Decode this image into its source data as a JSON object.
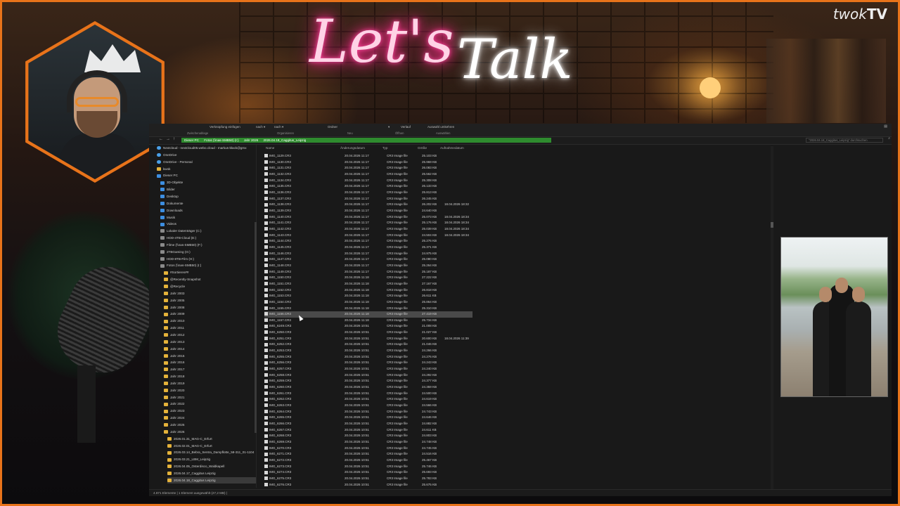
{
  "overlay": {
    "title_part1": "Let's",
    "title_part2": "Talk",
    "logo_part1": "twok",
    "logo_part2": "TV"
  },
  "ribbon": {
    "items": [
      "Verknüpfung einfügen",
      "nach ▾",
      "nach ▾",
      "Ordner",
      "▾",
      "Verlauf",
      "Auswahl umkehren"
    ],
    "groups": [
      "Zwischenablage",
      "Organisieren",
      "Neu",
      "Öffnen",
      "Auswählen"
    ]
  },
  "address": {
    "crumbs": [
      "Dieser PC",
      "Fotos (\\\\nas-SMB50) (I:)",
      "Jahr 2026",
      "2026.04.18_Caggitus_Leipzig"
    ],
    "search_placeholder": "\"2026.04.18_Caggitus_Leipzig\" durchsuchen"
  },
  "tree": [
    "Nextcloud - nextcloud05.webo.cloud - markus-black@gmx",
    "OneDrive",
    "OneDrive - Personal",
    "kwok",
    "Dieser PC",
    "3D-Objekte",
    "Bilder",
    "Desktop",
    "Dokumente",
    "Downloads",
    "Musik",
    "Videos",
    "Lokaler Datenträger (C:)",
    "HDD-4TB-Cloud (E:)",
    "Filme (\\\\nas-SMB50) (F:)",
    "2TBGaming (G:)",
    "HDD-8TB-Film (H:)",
    "Fotos (\\\\nas-SMB50) (I:)",
    "#Sortieren##",
    "@Recently-Snapshot",
    "@Recycle",
    "Jahr 2003",
    "Jahr 2005",
    "Jahr 2008",
    "Jahr 2009",
    "Jahr 2010",
    "Jahr 2011",
    "Jahr 2012",
    "Jahr 2013",
    "Jahr 2014",
    "Jahr 2015",
    "Jahr 2016",
    "Jahr 2017",
    "Jahr 2018",
    "Jahr 2019",
    "Jahr 2020",
    "Jahr 2021",
    "Jahr 2022",
    "Jahr 2023",
    "Jahr 2024",
    "Jahr 2025",
    "Jahr 2026",
    "2026.01.31_MAG-C_Erfurt",
    "2026.02.01_MAG-C_Erfurt",
    "2026.03.14_Bebra_Sentra_Dampflotte_58-311_01-1104",
    "2026.03.21_LBM_Leipzig",
    "2026.04.05_Osterdisco_Waldkapell",
    "2026.04.17_Caggitus Leipzig",
    "2026.04.18_Caggitus Leipzig"
  ],
  "columns": [
    "Name",
    "Änderungsdatum",
    "Typ",
    "Größe",
    "Aufnahmedatum"
  ],
  "files": [
    [
      "IMG_1129.CR3",
      "20.04.2026 11:17",
      "CR3 Image file",
      "25.103 KB",
      ""
    ],
    [
      "IMG_1130.CR3",
      "20.04.2026 11:17",
      "CR3 Image file",
      "25.969 KB",
      ""
    ],
    [
      "IMG_1131.CR3",
      "20.04.2026 11:17",
      "CR3 Image file",
      "26.083 KB",
      ""
    ],
    [
      "IMG_1132.CR3",
      "20.04.2026 11:17",
      "CR3 Image file",
      "25.562 KB",
      ""
    ],
    [
      "IMG_1134.CR3",
      "20.04.2026 11:17",
      "CR3 Image file",
      "25.308 KB",
      ""
    ],
    [
      "IMG_1135.CR3",
      "20.04.2026 11:17",
      "CR3 Image file",
      "26.133 KB",
      ""
    ],
    [
      "IMG_1136.CR3",
      "20.04.2026 11:17",
      "CR3 Image file",
      "25.813 KB",
      ""
    ],
    [
      "IMG_1137.CR3",
      "20.04.2026 11:17",
      "CR3 Image file",
      "26.245 KB",
      ""
    ],
    [
      "IMG_1138.CR3",
      "20.04.2026 11:17",
      "CR3 Image file",
      "26.202 KB",
      "18.04.2026 18:32"
    ],
    [
      "IMG_1139.CR3",
      "20.04.2026 11:17",
      "CR3 Image file",
      "24.640 KB",
      ""
    ],
    [
      "IMG_1140.CR3",
      "20.04.2026 11:17",
      "CR3 Image file",
      "25.073 KB",
      "18.04.2026 18:34"
    ],
    [
      "IMG_1141.CR3",
      "20.04.2026 11:17",
      "CR3 Image file",
      "25.176 KB",
      "18.04.2026 18:34"
    ],
    [
      "IMG_1142.CR3",
      "20.04.2026 11:17",
      "CR3 Image file",
      "25.039 KB",
      "18.04.2026 18:34"
    ],
    [
      "IMG_1143.CR3",
      "20.04.2026 11:17",
      "CR3 Image file",
      "24.504 KB",
      "18.04.2026 18:34"
    ],
    [
      "IMG_1144.CR3",
      "20.04.2026 11:17",
      "CR3 Image file",
      "25.276 KB",
      ""
    ],
    [
      "IMG_1145.CR3",
      "20.04.2026 11:17",
      "CR3 Image file",
      "25.371 KB",
      ""
    ],
    [
      "IMG_1146.CR3",
      "20.04.2026 11:17",
      "CR3 Image file",
      "24.975 KB",
      ""
    ],
    [
      "IMG_1147.CR3",
      "20.04.2026 11:17",
      "CR3 Image file",
      "25.080 KB",
      ""
    ],
    [
      "IMG_1148.CR3",
      "20.04.2026 11:17",
      "CR3 Image file",
      "25.264 KB",
      ""
    ],
    [
      "IMG_1149.CR3",
      "20.04.2026 11:17",
      "CR3 Image file",
      "25.187 KB",
      ""
    ],
    [
      "IMG_1150.CR3",
      "20.04.2026 11:18",
      "CR3 Image file",
      "27.222 KB",
      ""
    ],
    [
      "IMG_1151.CR3",
      "20.04.2026 11:18",
      "CR3 Image file",
      "27.167 KB",
      ""
    ],
    [
      "IMG_1152.CR3",
      "20.04.2026 11:18",
      "CR3 Image file",
      "26.818 KB",
      ""
    ],
    [
      "IMG_1153.CR3",
      "20.04.2026 11:18",
      "CR3 Image file",
      "26.611 KB",
      ""
    ],
    [
      "IMG_1154.CR3",
      "20.04.2026 11:18",
      "CR3 Image file",
      "25.864 KB",
      ""
    ],
    [
      "IMG_1155.CR3",
      "20.04.2026 11:18",
      "CR3 Image file",
      "25.310 KB",
      ""
    ],
    [
      "IMG_1156.CR3",
      "20.04.2026 11:18",
      "CR3 Image file",
      "27.419 KB",
      ""
    ],
    [
      "IMG_1157.CR3",
      "20.04.2026 11:18",
      "CR3 Image file",
      "25.734 KB",
      ""
    ],
    [
      "IMG_6249.CR3",
      "20.04.2026 10:51",
      "CR3 Image file",
      "21.008 KB",
      ""
    ],
    [
      "IMG_6250.CR3",
      "20.04.2026 10:51",
      "CR3 Image file",
      "21.027 KB",
      ""
    ],
    [
      "IMG_6251.CR3",
      "20.04.2026 10:51",
      "CR3 Image file",
      "20.600 KB",
      "18.04.2026 11:39"
    ],
    [
      "IMG_6252.CR3",
      "20.04.2026 10:51",
      "CR3 Image file",
      "21.046 KB",
      ""
    ],
    [
      "IMG_6253.CR3",
      "20.04.2026 10:51",
      "CR3 Image file",
      "24.266 KB",
      ""
    ],
    [
      "IMG_6255.CR3",
      "20.04.2026 10:51",
      "CR3 Image file",
      "24.276 KB",
      ""
    ],
    [
      "IMG_6256.CR3",
      "20.04.2026 10:51",
      "CR3 Image file",
      "24.243 KB",
      ""
    ],
    [
      "IMG_6257.CR3",
      "20.04.2026 10:51",
      "CR3 Image file",
      "24.240 KB",
      ""
    ],
    [
      "IMG_6258.CR3",
      "20.04.2026 10:51",
      "CR3 Image file",
      "24.292 KB",
      ""
    ],
    [
      "IMG_6259.CR3",
      "20.04.2026 10:51",
      "CR3 Image file",
      "24.377 KB",
      ""
    ],
    [
      "IMG_6260.CR3",
      "20.04.2026 10:51",
      "CR3 Image file",
      "24.359 KB",
      ""
    ],
    [
      "IMG_6261.CR3",
      "20.04.2026 10:51",
      "CR3 Image file",
      "24.500 KB",
      ""
    ],
    [
      "IMG_6262.CR3",
      "20.04.2026 10:51",
      "CR3 Image file",
      "24.619 KB",
      ""
    ],
    [
      "IMG_6263.CR3",
      "20.04.2026 10:51",
      "CR3 Image file",
      "24.566 KB",
      ""
    ],
    [
      "IMG_6264.CR3",
      "20.04.2026 10:51",
      "CR3 Image file",
      "24.743 KB",
      ""
    ],
    [
      "IMG_6265.CR3",
      "20.04.2026 10:51",
      "CR3 Image file",
      "24.646 KB",
      ""
    ],
    [
      "IMG_6266.CR3",
      "20.04.2026 10:51",
      "CR3 Image file",
      "24.882 KB",
      ""
    ],
    [
      "IMG_6267.CR3",
      "20.04.2026 10:51",
      "CR3 Image file",
      "24.611 KB",
      ""
    ],
    [
      "IMG_6268.CR3",
      "20.04.2026 10:51",
      "CR3 Image file",
      "24.803 KB",
      ""
    ],
    [
      "IMG_6269.CR3",
      "20.04.2026 10:51",
      "CR3 Image file",
      "24.748 KB",
      ""
    ],
    [
      "IMG_6270.CR3",
      "20.04.2026 10:51",
      "CR3 Image file",
      "24.745 KB",
      ""
    ],
    [
      "IMG_6271.CR3",
      "20.04.2026 10:51",
      "CR3 Image file",
      "24.516 KB",
      ""
    ],
    [
      "IMG_6272.CR3",
      "20.04.2026 10:51",
      "CR3 Image file",
      "25.467 KB",
      ""
    ],
    [
      "IMG_6273.CR3",
      "20.04.2026 10:51",
      "CR3 Image file",
      "25.746 KB",
      ""
    ],
    [
      "IMG_6274.CR3",
      "20.04.2026 10:51",
      "CR3 Image file",
      "25.693 KB",
      ""
    ],
    [
      "IMG_6275.CR3",
      "20.04.2026 10:51",
      "CR3 Image file",
      "25.783 KB",
      ""
    ],
    [
      "IMG_6276.CR3",
      "20.04.2026 10:51",
      "CR3 Image file",
      "25.675 KB",
      ""
    ]
  ],
  "selected_file": "IMG_1156.CR3",
  "status": "4.871 Elemente | 1 Element ausgewählt (27,2 MB) |",
  "colors": {
    "accent": "#e8731a",
    "breadcrumb": "#2e8b2e",
    "folder": "#e4b23a"
  }
}
